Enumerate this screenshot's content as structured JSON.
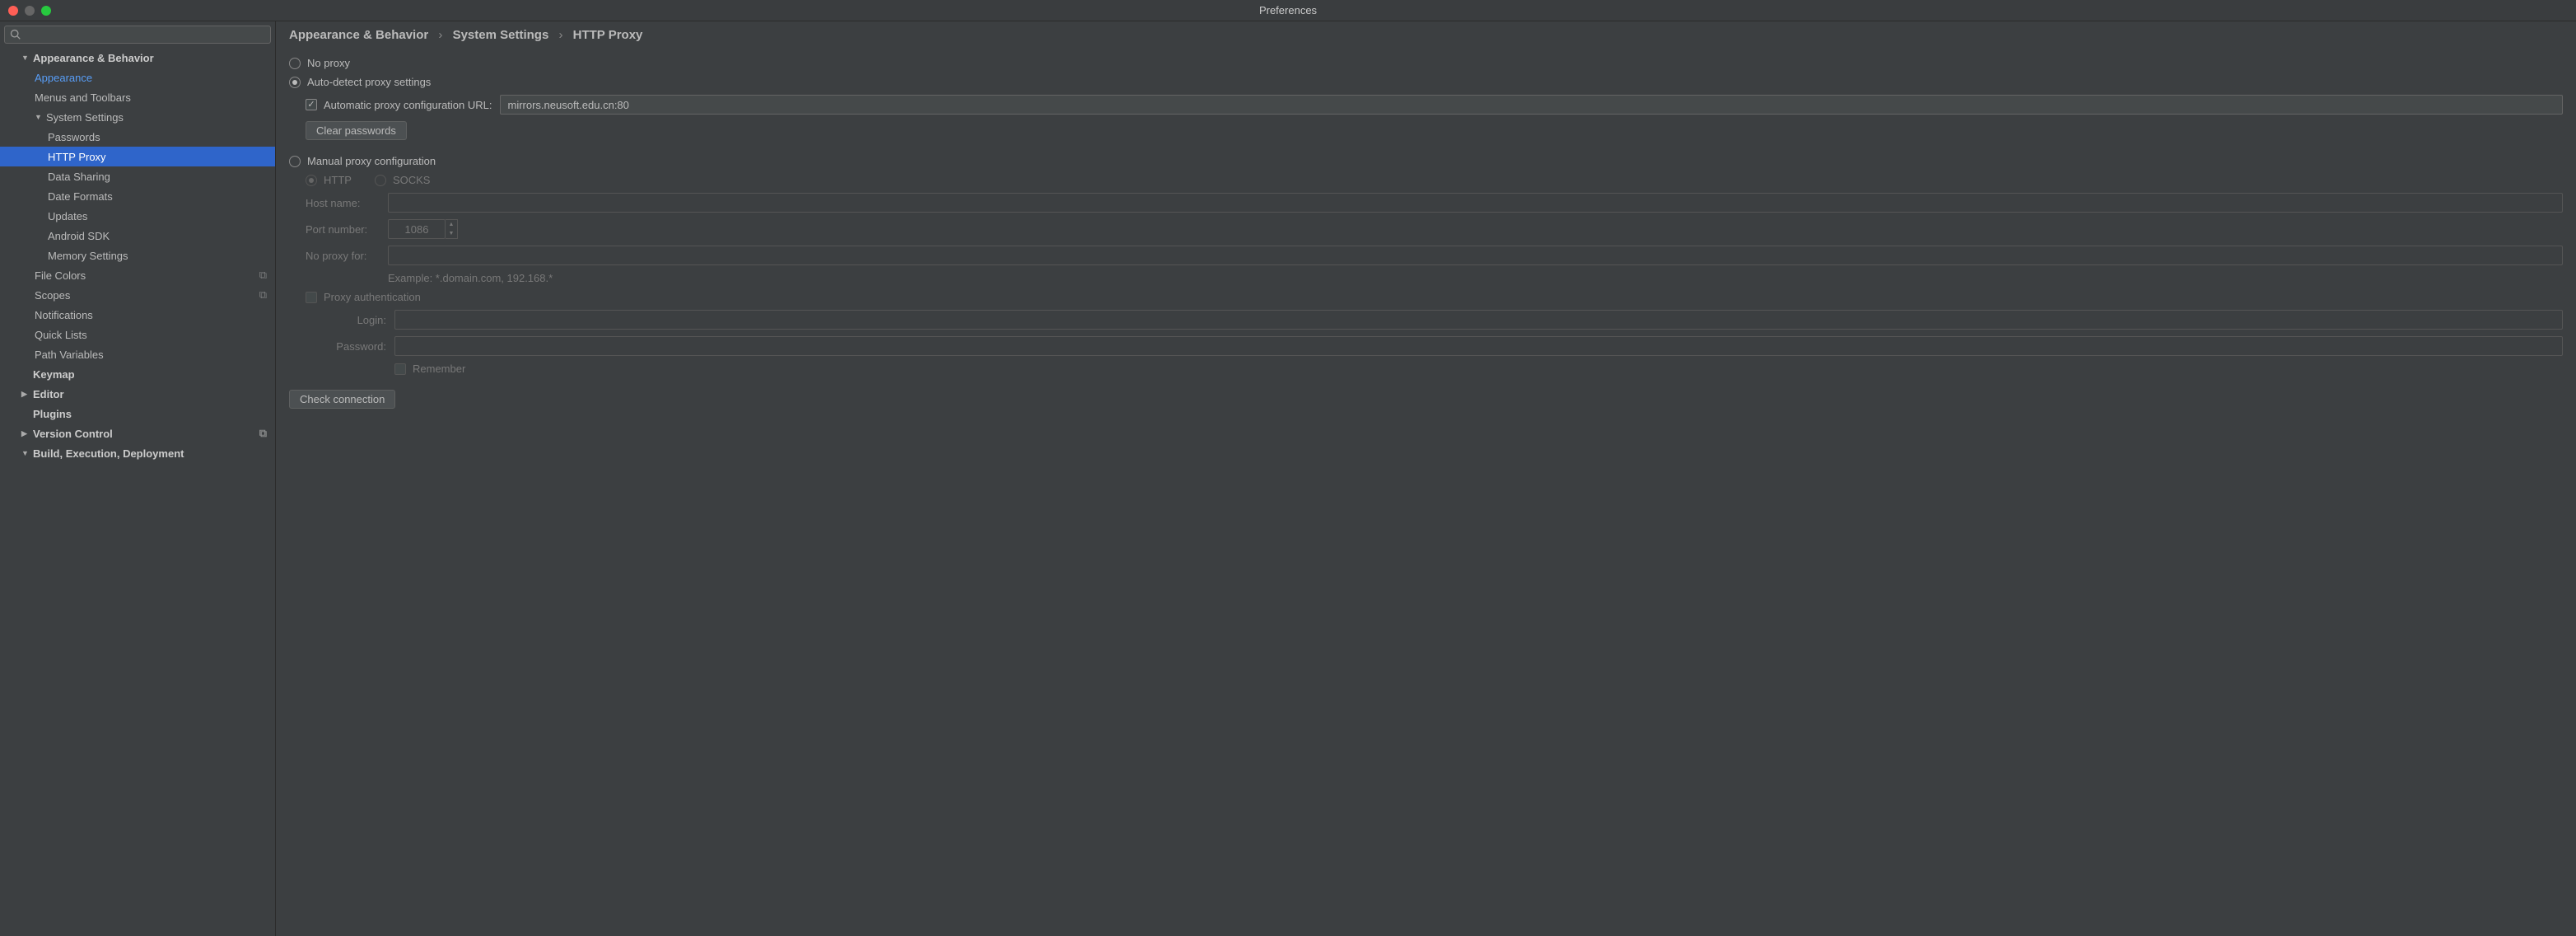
{
  "window": {
    "title": "Preferences"
  },
  "breadcrumb": {
    "l1": "Appearance & Behavior",
    "l2": "System Settings",
    "l3": "HTTP Proxy",
    "sep": "›"
  },
  "tree": {
    "appearance_behavior": "Appearance & Behavior",
    "appearance": "Appearance",
    "menus_toolbars": "Menus and Toolbars",
    "system_settings": "System Settings",
    "passwords": "Passwords",
    "http_proxy": "HTTP Proxy",
    "data_sharing": "Data Sharing",
    "date_formats": "Date Formats",
    "updates": "Updates",
    "android_sdk": "Android SDK",
    "memory_settings": "Memory Settings",
    "file_colors": "File Colors",
    "scopes": "Scopes",
    "notifications": "Notifications",
    "quick_lists": "Quick Lists",
    "path_variables": "Path Variables",
    "keymap": "Keymap",
    "editor": "Editor",
    "plugins": "Plugins",
    "version_control": "Version Control",
    "build": "Build, Execution, Deployment"
  },
  "proxy": {
    "no_proxy": "No proxy",
    "auto_detect": "Auto-detect proxy settings",
    "auto_config_url_label": "Automatic proxy configuration URL:",
    "auto_config_url_value": "mirrors.neusoft.edu.cn:80",
    "clear_passwords": "Clear passwords",
    "manual": "Manual proxy configuration",
    "http": "HTTP",
    "socks": "SOCKS",
    "host_label": "Host name:",
    "port_label": "Port number:",
    "port_value": "1086",
    "no_proxy_for_label": "No proxy for:",
    "example": "Example: *.domain.com, 192.168.*",
    "proxy_auth": "Proxy authentication",
    "login_label": "Login:",
    "password_label": "Password:",
    "remember": "Remember",
    "check_connection": "Check connection"
  }
}
